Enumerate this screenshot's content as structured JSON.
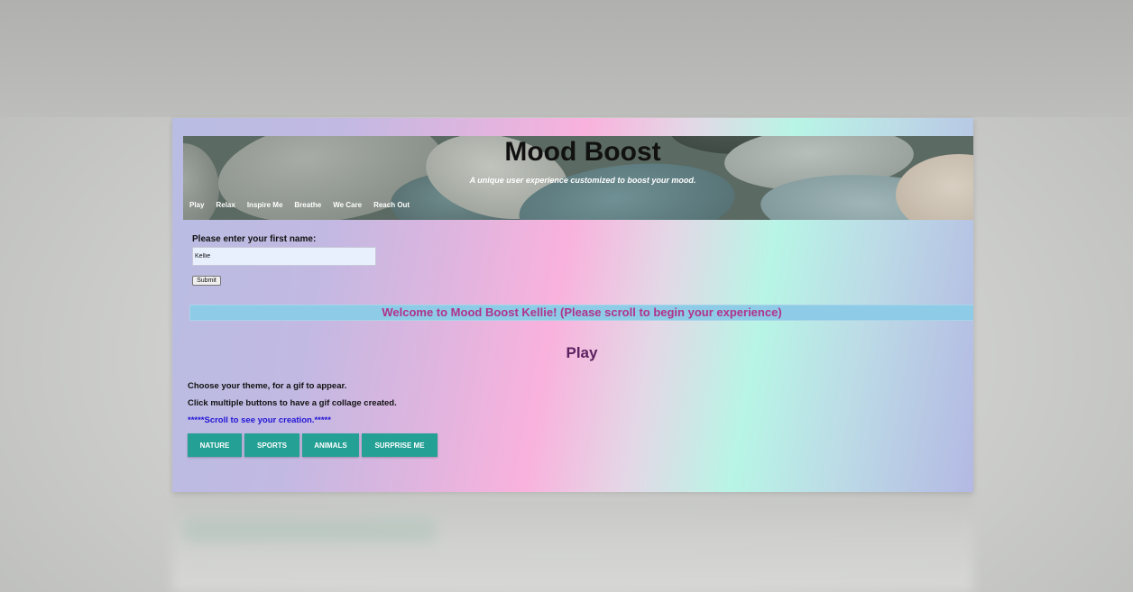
{
  "site": {
    "title": "Mood Boost",
    "subtitle": "A unique user experience customized to boost your mood."
  },
  "nav": {
    "items": [
      {
        "label": "Play"
      },
      {
        "label": "Relax"
      },
      {
        "label": "Inspire Me"
      },
      {
        "label": "Breathe"
      },
      {
        "label": "We Care"
      },
      {
        "label": "Reach Out"
      }
    ]
  },
  "name_form": {
    "label": "Please enter your first name:",
    "value": "Kellie",
    "submit_label": "Submit"
  },
  "welcome": {
    "message": "Welcome to Mood Boost Kellie! (Please scroll to begin your experience)"
  },
  "play": {
    "heading": "Play",
    "instruction_1": "Choose your theme, for a gif to appear.",
    "instruction_2": "Click multiple buttons to have a gif collage created.",
    "instruction_3": "*****Scroll to see your creation.*****",
    "buttons": {
      "nature": "NATURE",
      "sports": "SPORTS",
      "animals": "ANIMALS",
      "surprise": "SURPRISE ME"
    }
  },
  "colors": {
    "welcome_text": "#b0338a",
    "welcome_bg": "#8ecbe6",
    "button_bg": "#24a095",
    "scroll_note": "#2214d6",
    "play_heading": "#5c2260"
  }
}
